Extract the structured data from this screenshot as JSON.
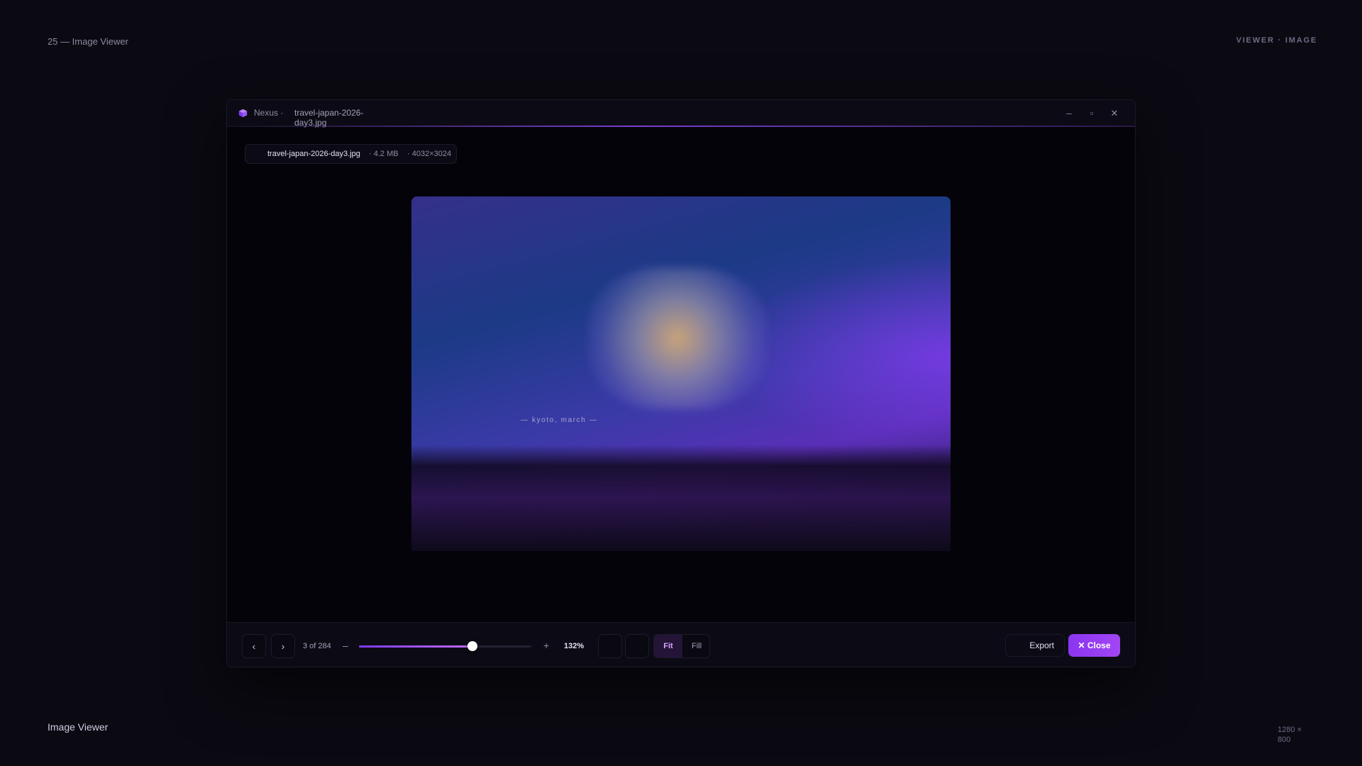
{
  "page": {
    "top_left_label": "25 — Image Viewer",
    "top_right_label": "VIEWER · IMAGE",
    "bottom_left_label": "Image Viewer",
    "bottom_right_label": "1280 × 800"
  },
  "window": {
    "app_name": "Nexus ·",
    "file_title": "travel-japan-2026-day3.jpg",
    "controls": {
      "minimize": "–",
      "maximize": "▫",
      "close": "✕"
    }
  },
  "file_info": {
    "name": "travel-japan-2026-day3.jpg",
    "size": "· 4.2 MB",
    "dimensions": "· 4032×3024"
  },
  "image": {
    "caption": "— kyoto, march —"
  },
  "toolbar": {
    "prev": "‹",
    "next": "›",
    "counter": "3 of 284",
    "zoom_minus": "–",
    "zoom_plus": "+",
    "zoom_value": "132%",
    "zoom_slider_fraction": 0.66,
    "fit_label": "Fit",
    "fill_label": "Fill",
    "export_label": "Export",
    "close_label": "✕ Close"
  },
  "colors": {
    "accent": "#8b35f0",
    "background": "#0b0a12"
  }
}
